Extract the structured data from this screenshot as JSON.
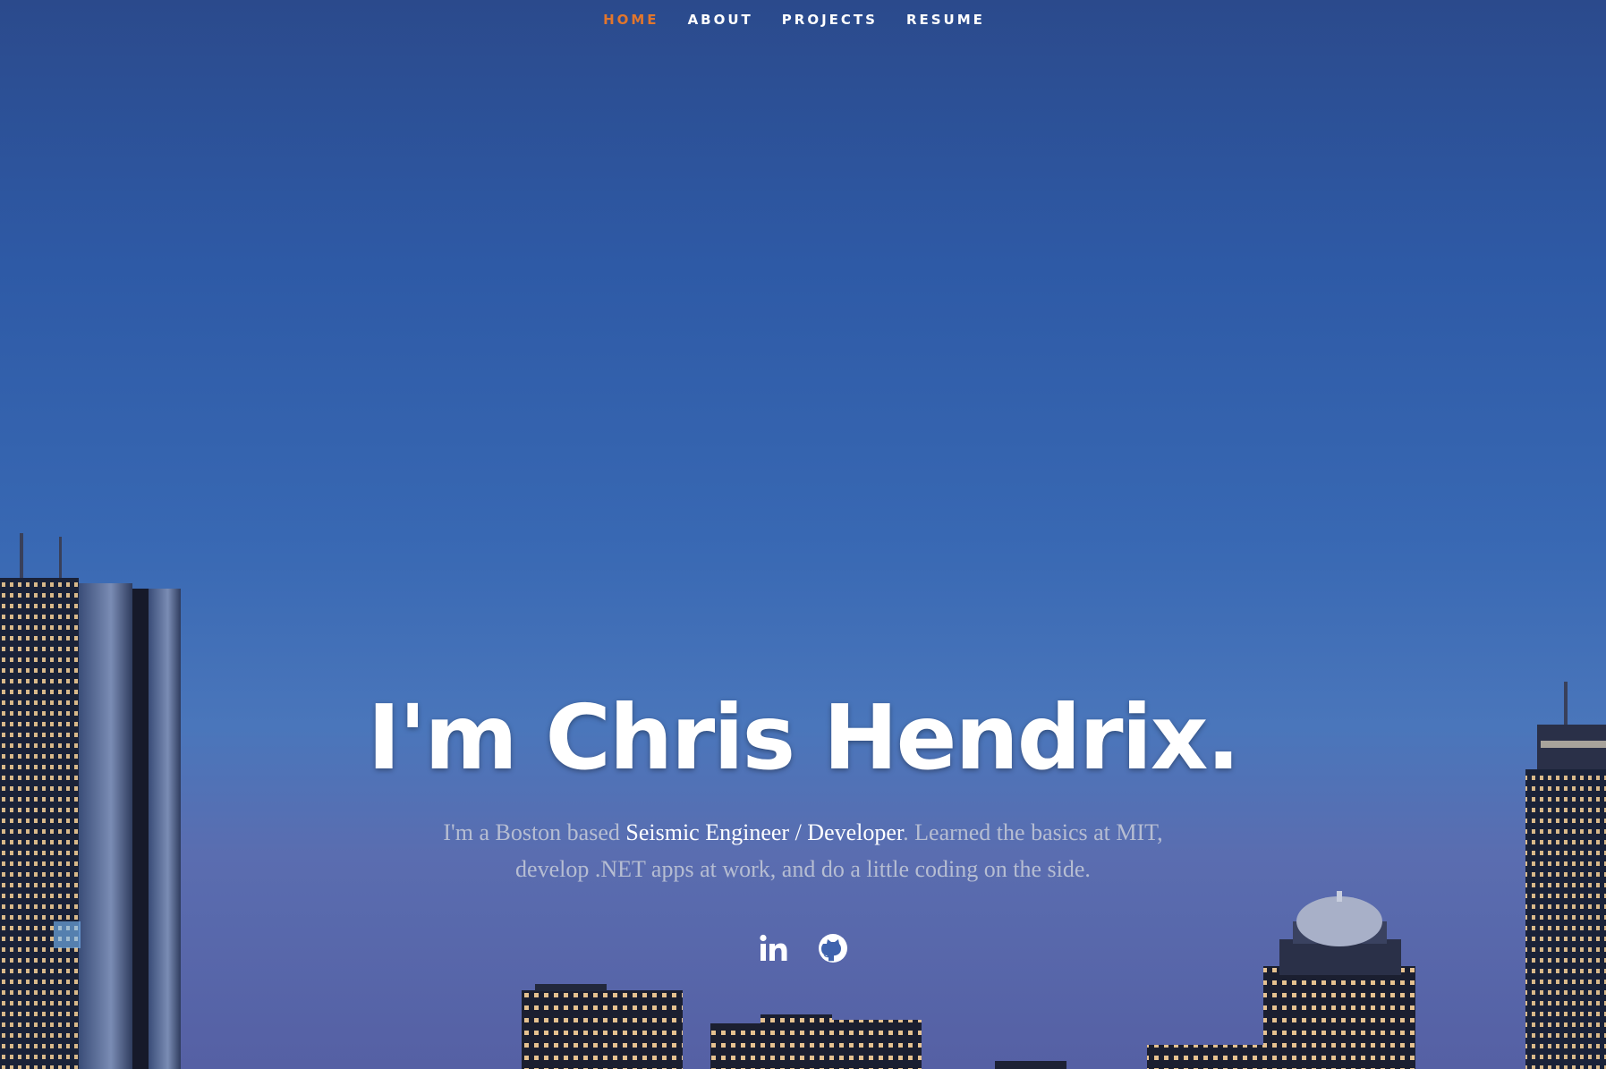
{
  "nav": {
    "items": [
      {
        "label": "Home",
        "active": true
      },
      {
        "label": "About",
        "active": false
      },
      {
        "label": "Projects",
        "active": false
      },
      {
        "label": "Resume",
        "active": false
      }
    ],
    "active_color": "#e2762c"
  },
  "hero": {
    "title": "I'm Chris Hendrix.",
    "intro_pre": "I'm a Boston based ",
    "intro_highlight": "Seismic Engineer / Developer",
    "intro_post": ". Learned the basics at MIT, develop .NET apps at work, and do a little coding on the side."
  },
  "social": {
    "icons": [
      "linkedin-icon",
      "github-icon"
    ]
  },
  "colors": {
    "sky_top": "#2b4a8c",
    "sky_bottom": "#5560a4",
    "text_muted": "#b6bdd2"
  }
}
